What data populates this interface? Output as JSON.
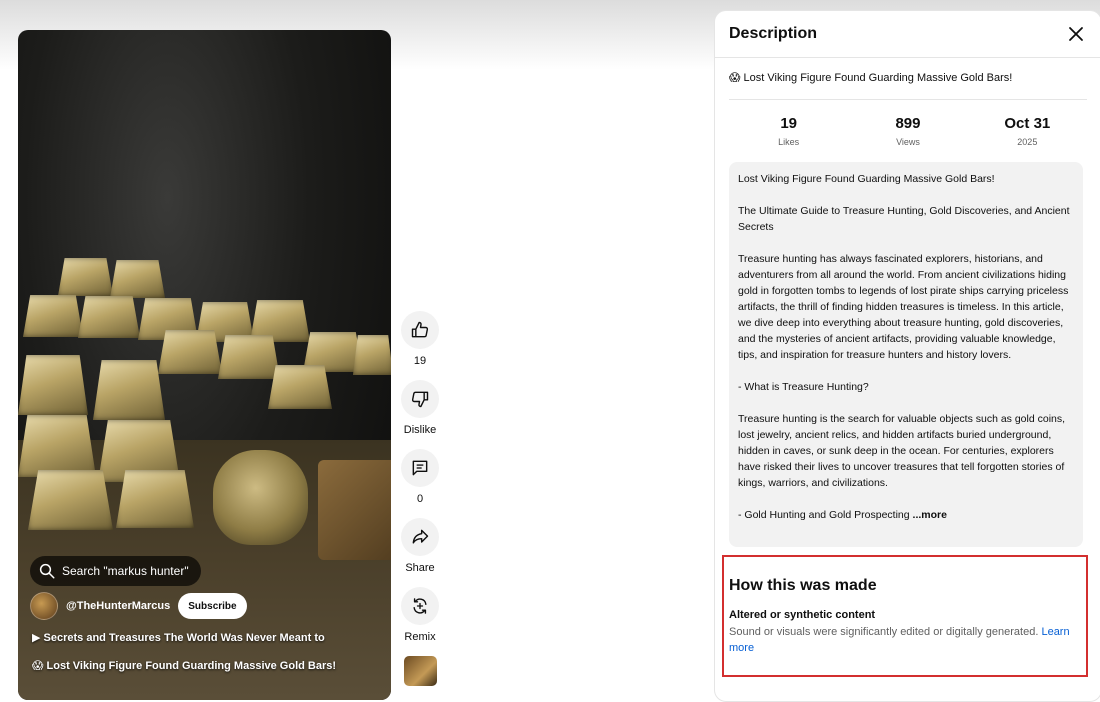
{
  "video": {
    "search_label": "Search \"markus hunter\"",
    "channel_name": "@TheHunterMarcus",
    "subscribe_label": "Subscribe",
    "playlist_line": "▶ Secrets and Treasures The World Was Never Meant to",
    "title_line": "😱 Lost Viking Figure Found Guarding Massive Gold Bars!"
  },
  "actions": {
    "like_count": "19",
    "dislike_label": "Dislike",
    "comment_count": "0",
    "share_label": "Share",
    "remix_label": "Remix"
  },
  "panel": {
    "title": "Description",
    "video_title": "😱 Lost Viking Figure Found Guarding Massive Gold Bars!",
    "stats": [
      {
        "value": "19",
        "label": "Likes"
      },
      {
        "value": "899",
        "label": "Views"
      },
      {
        "value": "Oct 31",
        "label": "2025"
      }
    ],
    "description": {
      "p1": "Lost Viking Figure Found Guarding Massive Gold Bars!",
      "p2": "The Ultimate Guide to Treasure Hunting, Gold Discoveries, and Ancient Secrets",
      "p3": "Treasure hunting has always fascinated explorers, historians, and adventurers from all around the world. From ancient civilizations hiding gold in forgotten tombs to legends of lost pirate ships carrying priceless artifacts, the thrill of finding hidden treasures is timeless. In this article, we dive deep into everything about treasure hunting, gold discoveries, and the mysteries of ancient artifacts, providing valuable knowledge, tips, and inspiration for treasure hunters and history lovers.",
      "p4": "- What is Treasure Hunting?",
      "p5": "Treasure hunting is the search for valuable objects such as gold coins, lost jewelry, ancient relics, and hidden artifacts buried underground, hidden in caves, or sunk deep in the ocean. For centuries, explorers have risked their lives to uncover treasures that tell forgotten stories of kings, warriors, and civilizations.",
      "p6": "- Gold Hunting and Gold Prospecting ",
      "more_label": "...more"
    },
    "how_made": {
      "title": "How this was made",
      "subtitle": "Altered or synthetic content",
      "text": "Sound or visuals were significantly edited or digitally generated. ",
      "learn_more": "Learn more"
    }
  }
}
